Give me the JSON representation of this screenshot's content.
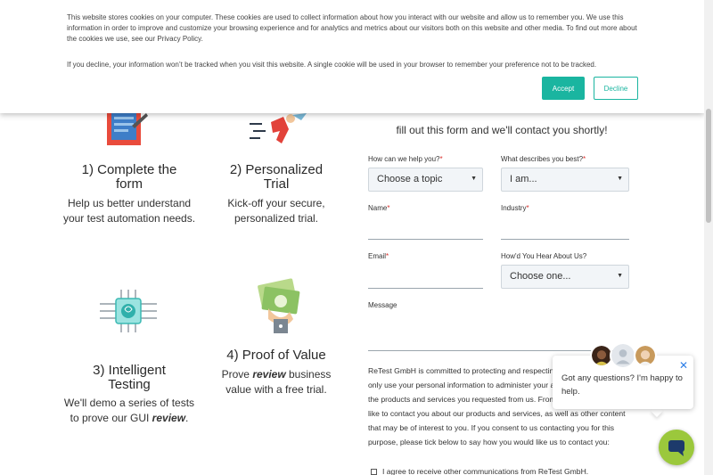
{
  "cookie_banner": {
    "text1": "This website stores cookies on your computer. These cookies are used to collect information about how you interact with our website and allow us to remember you. We use this information in order to improve and customize your browsing experience and for analytics and metrics about our visitors both on this website and other media. To find out more about the cookies we use, see our Privacy Policy.",
    "text2": "If you decline, your information won’t be tracked when you visit this website. A single cookie will be used in your browser to remember your preference not to be tracked.",
    "accept_label": "Accept",
    "decline_label": "Decline"
  },
  "steps": [
    {
      "title": "1) Complete the form",
      "desc": "Help us better understand your test automation needs.",
      "icon": "form-icon"
    },
    {
      "title": "2) Personalized Trial",
      "desc": "Kick-off your secure, personalized trial.",
      "icon": "rocket-icon"
    },
    {
      "title": "3) Intelligent Testing",
      "desc_pre": "We'll demo a series of tests to prove our GUI ",
      "desc_em": "review",
      "desc_post": ".",
      "icon": "chip-icon"
    },
    {
      "title": "4) Proof of Value",
      "desc_pre": "Prove ",
      "desc_em": "review",
      "desc_post": " business value with a free trial.",
      "icon": "money-icon"
    }
  ],
  "form": {
    "subtitle": "fill out this form and we'll contact you shortly!",
    "help_label": "How can we help you?",
    "help_value": "Choose a topic",
    "describes_label": "What describes you best?",
    "describes_value": "I am...",
    "name_label": "Name",
    "industry_label": "Industry",
    "email_label": "Email",
    "hear_label": "How'd You Hear About Us?",
    "hear_value": "Choose one...",
    "message_label": "Message",
    "required_mark": "*",
    "consent_text": "ReTest GmbH is committed to protecting and respecting your privacy, and we'll only use your personal information to administer your account and to provide the products and services you requested from us. From time to time, we would like to contact you about our products and services, as well as other content that may be of interest to you. If you consent to us contacting you for this purpose, please tick below to say how you would like us to contact you:",
    "checkbox_label": "I agree to receive other communications from ReTest GmbH."
  },
  "chat": {
    "message": "Got any questions? I'm happy to help.",
    "close_symbol": "✕"
  },
  "colors": {
    "accent": "#1ab5a0",
    "required": "#d9302c",
    "chat_launcher": "#9bc83c"
  }
}
